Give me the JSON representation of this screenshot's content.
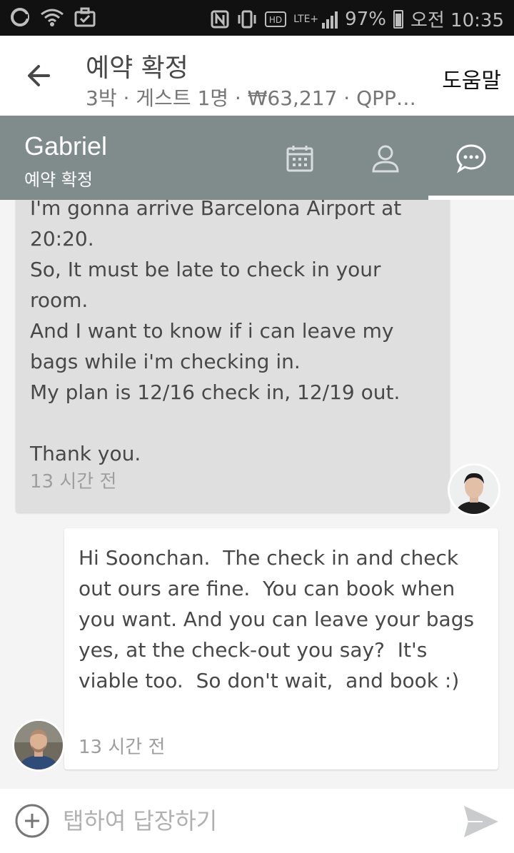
{
  "status_bar": {
    "battery": "97%",
    "time": "오전 10:35",
    "network": "LTE+",
    "icons": [
      "carrier-icon",
      "wifi-icon",
      "briefcase-check-icon",
      "nfc-icon",
      "vibrate-icon",
      "hd-icon",
      "signal-icon",
      "battery-icon"
    ]
  },
  "header": {
    "title": "예약 확정",
    "subtitle": "3박 · 게스트 1명 · ₩63,217 · QPP…",
    "help": "도움말"
  },
  "conversation": {
    "name": "Gabriel",
    "status": "예약 확정",
    "tabs": [
      "calendar-icon",
      "person-icon",
      "chat-icon"
    ],
    "active_tab": "chat-icon"
  },
  "messages": [
    {
      "direction": "incoming",
      "text": "I'm gonna arrive Barcelona Airport at 20:20.\nSo, It must be late to check in your room.\nAnd I want to know if i can leave my bags while i'm checking in.\nMy plan is 12/16 check in, 12/19 out.\n\nThank you.",
      "time": "13 시간 전"
    },
    {
      "direction": "outgoing",
      "text": "Hi Soonchan.  The check in and check out ours are fine.  You can book when you want. And you can leave your bags yes, at the check-out you say?  It's viable too.  So don't wait,  and book :)",
      "time": "13 시간 전"
    }
  ],
  "composer": {
    "placeholder": "탭하여 답장하기"
  },
  "colors": {
    "bar_gray": "#808b8c",
    "incoming_bubble": "#dfdfdf",
    "text": "#484848"
  }
}
